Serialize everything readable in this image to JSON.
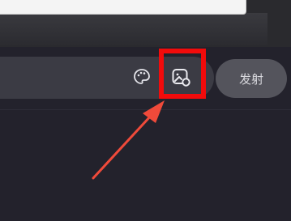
{
  "composer": {
    "input_value": "",
    "send_label": "发射"
  },
  "icons": {
    "palette": "palette-icon",
    "image": "image-upload-icon"
  },
  "annotation": {
    "highlight_color": "#f20b0b",
    "arrow_color": "#ef4a3a"
  }
}
